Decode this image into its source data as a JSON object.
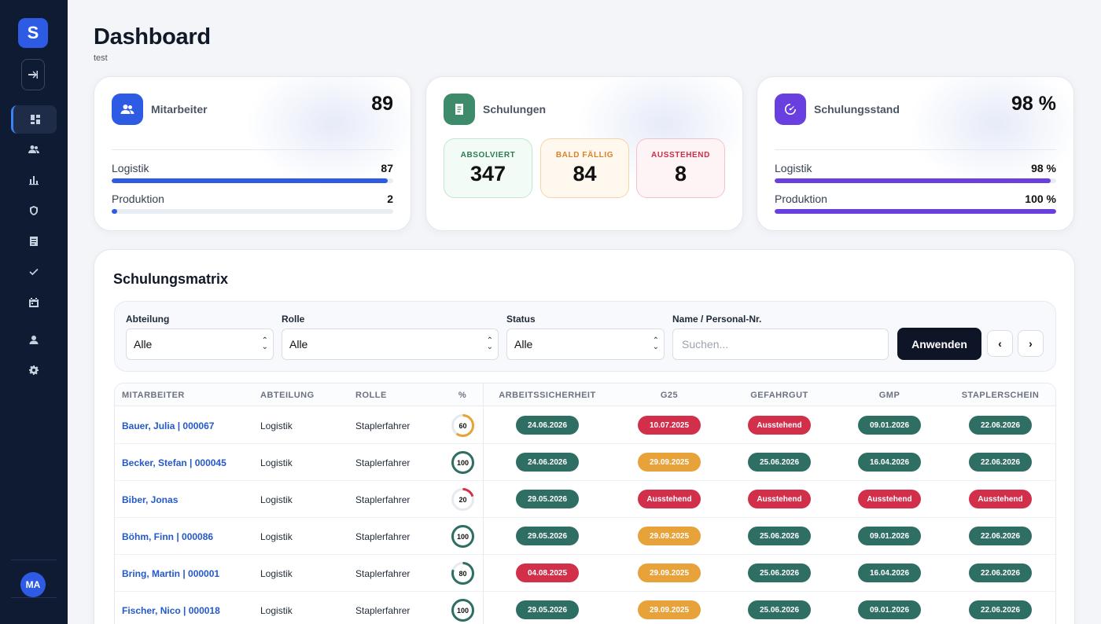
{
  "sidebar": {
    "logo": "S",
    "avatar": "MA",
    "nav_icons": [
      "dashboard-icon",
      "users-icon",
      "chart-icon",
      "shield-icon",
      "document-icon",
      "check-icon",
      "calendar-icon",
      "user-badge-icon",
      "gear-icon"
    ]
  },
  "header": {
    "title": "Dashboard",
    "subtitle": "test"
  },
  "cards": {
    "employees": {
      "title": "Mitarbeiter",
      "value": "89",
      "rows": [
        {
          "label": "Logistik",
          "value": "87",
          "fraction": 0.98
        },
        {
          "label": "Produktion",
          "value": "2",
          "fraction": 0.02
        }
      ],
      "accent": "#2d5be3"
    },
    "trainings": {
      "title": "Schulungen",
      "stats": [
        {
          "label": "ABSOLVIERT",
          "value": "347"
        },
        {
          "label": "BALD FÄLLIG",
          "value": "84"
        },
        {
          "label": "AUSSTEHEND",
          "value": "8"
        }
      ],
      "accent": "#3d8b6a"
    },
    "progress": {
      "title": "Schulungsstand",
      "value": "98 %",
      "rows": [
        {
          "label": "Logistik",
          "value": "98 %",
          "fraction": 0.98
        },
        {
          "label": "Produktion",
          "value": "100 %",
          "fraction": 1.0
        }
      ],
      "accent": "#6a3fe0"
    }
  },
  "matrix": {
    "title": "Schulungsmatrix",
    "filters": {
      "department": {
        "label": "Abteilung",
        "value": "Alle"
      },
      "role": {
        "label": "Rolle",
        "value": "Alle"
      },
      "status": {
        "label": "Status",
        "value": "Alle"
      },
      "search": {
        "label": "Name / Personal-Nr.",
        "placeholder": "Suchen..."
      },
      "apply": "Anwenden",
      "prev": "‹",
      "next": "›"
    },
    "columns": [
      "MITARBEITER",
      "ABTEILUNG",
      "ROLLE",
      "%",
      "ARBEITSSICHERHEIT",
      "G25",
      "GEFAHRGUT",
      "GMP",
      "STAPLERSCHEIN"
    ],
    "rows": [
      {
        "name": "Bauer, Julia | 000067",
        "dept": "Logistik",
        "role": "Staplerfahrer",
        "percent": 60,
        "cells": [
          {
            "t": "24.06.2026",
            "s": "green"
          },
          {
            "t": "10.07.2025",
            "s": "red"
          },
          {
            "t": "Ausstehend",
            "s": "red"
          },
          {
            "t": "09.01.2026",
            "s": "green"
          },
          {
            "t": "22.06.2026",
            "s": "green"
          }
        ]
      },
      {
        "name": "Becker, Stefan | 000045",
        "dept": "Logistik",
        "role": "Staplerfahrer",
        "percent": 100,
        "cells": [
          {
            "t": "24.06.2026",
            "s": "green"
          },
          {
            "t": "29.09.2025",
            "s": "orange"
          },
          {
            "t": "25.06.2026",
            "s": "green"
          },
          {
            "t": "16.04.2026",
            "s": "green"
          },
          {
            "t": "22.06.2026",
            "s": "green"
          }
        ]
      },
      {
        "name": "Biber, Jonas",
        "dept": "Logistik",
        "role": "Staplerfahrer",
        "percent": 20,
        "cells": [
          {
            "t": "29.05.2026",
            "s": "green"
          },
          {
            "t": "Ausstehend",
            "s": "red"
          },
          {
            "t": "Ausstehend",
            "s": "red"
          },
          {
            "t": "Ausstehend",
            "s": "red"
          },
          {
            "t": "Ausstehend",
            "s": "red"
          }
        ]
      },
      {
        "name": "Böhm, Finn | 000086",
        "dept": "Logistik",
        "role": "Staplerfahrer",
        "percent": 100,
        "cells": [
          {
            "t": "29.05.2026",
            "s": "green"
          },
          {
            "t": "29.09.2025",
            "s": "orange"
          },
          {
            "t": "25.06.2026",
            "s": "green"
          },
          {
            "t": "09.01.2026",
            "s": "green"
          },
          {
            "t": "22.06.2026",
            "s": "green"
          }
        ]
      },
      {
        "name": "Bring, Martin | 000001",
        "dept": "Logistik",
        "role": "Staplerfahrer",
        "percent": 80,
        "cells": [
          {
            "t": "04.08.2025",
            "s": "red"
          },
          {
            "t": "29.09.2025",
            "s": "orange"
          },
          {
            "t": "25.06.2026",
            "s": "green"
          },
          {
            "t": "16.04.2026",
            "s": "green"
          },
          {
            "t": "22.06.2026",
            "s": "green"
          }
        ]
      },
      {
        "name": "Fischer, Nico | 000018",
        "dept": "Logistik",
        "role": "Staplerfahrer",
        "percent": 100,
        "cells": [
          {
            "t": "29.05.2026",
            "s": "green"
          },
          {
            "t": "29.09.2025",
            "s": "orange"
          },
          {
            "t": "25.06.2026",
            "s": "green"
          },
          {
            "t": "09.01.2026",
            "s": "green"
          },
          {
            "t": "22.06.2026",
            "s": "green"
          }
        ]
      }
    ]
  }
}
